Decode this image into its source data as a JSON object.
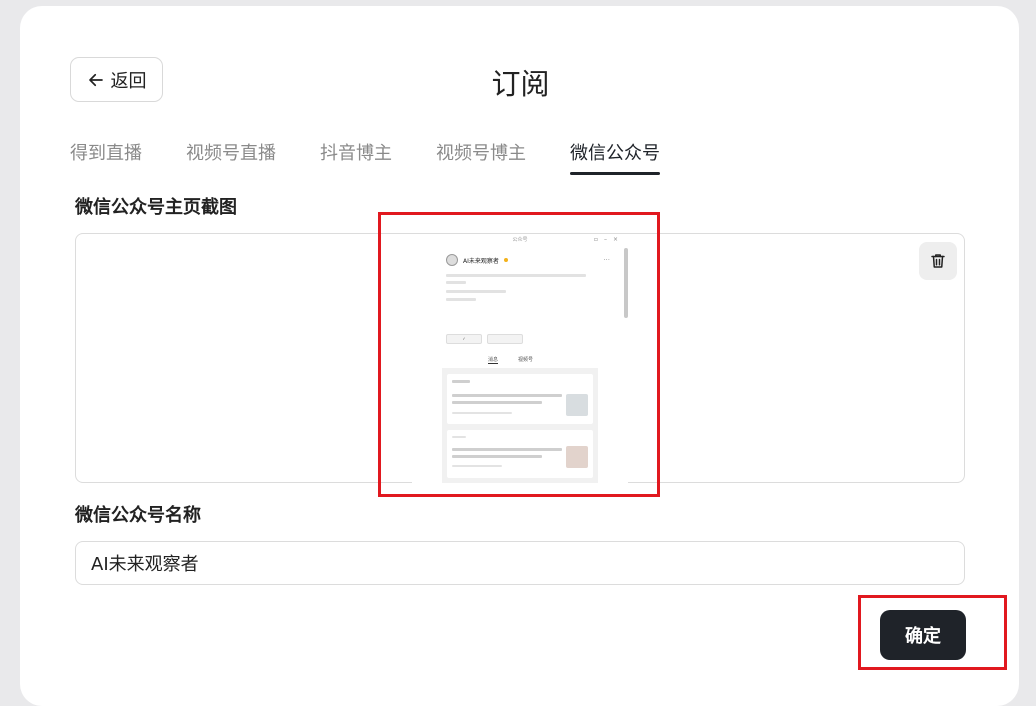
{
  "header": {
    "back_label": "返回",
    "title": "订阅"
  },
  "tabs": [
    {
      "label": "得到直播",
      "active": false
    },
    {
      "label": "视频号直播",
      "active": false
    },
    {
      "label": "抖音博主",
      "active": false
    },
    {
      "label": "视频号博主",
      "active": false
    },
    {
      "label": "微信公众号",
      "active": true
    }
  ],
  "form": {
    "screenshot_label": "微信公众号主页截图",
    "name_label": "微信公众号名称",
    "name_value": "AI未来观察者",
    "confirm_label": "确定"
  },
  "uploaded_screenshot": {
    "window_title": "公众号",
    "account_name": "AI未来观察者",
    "tabs": [
      "消息",
      "视频号"
    ]
  },
  "colors": {
    "accent_dark": "#1f2329",
    "highlight_red": "#e1181f"
  },
  "icons": {
    "back": "arrow-left-icon",
    "delete": "trash-icon"
  }
}
